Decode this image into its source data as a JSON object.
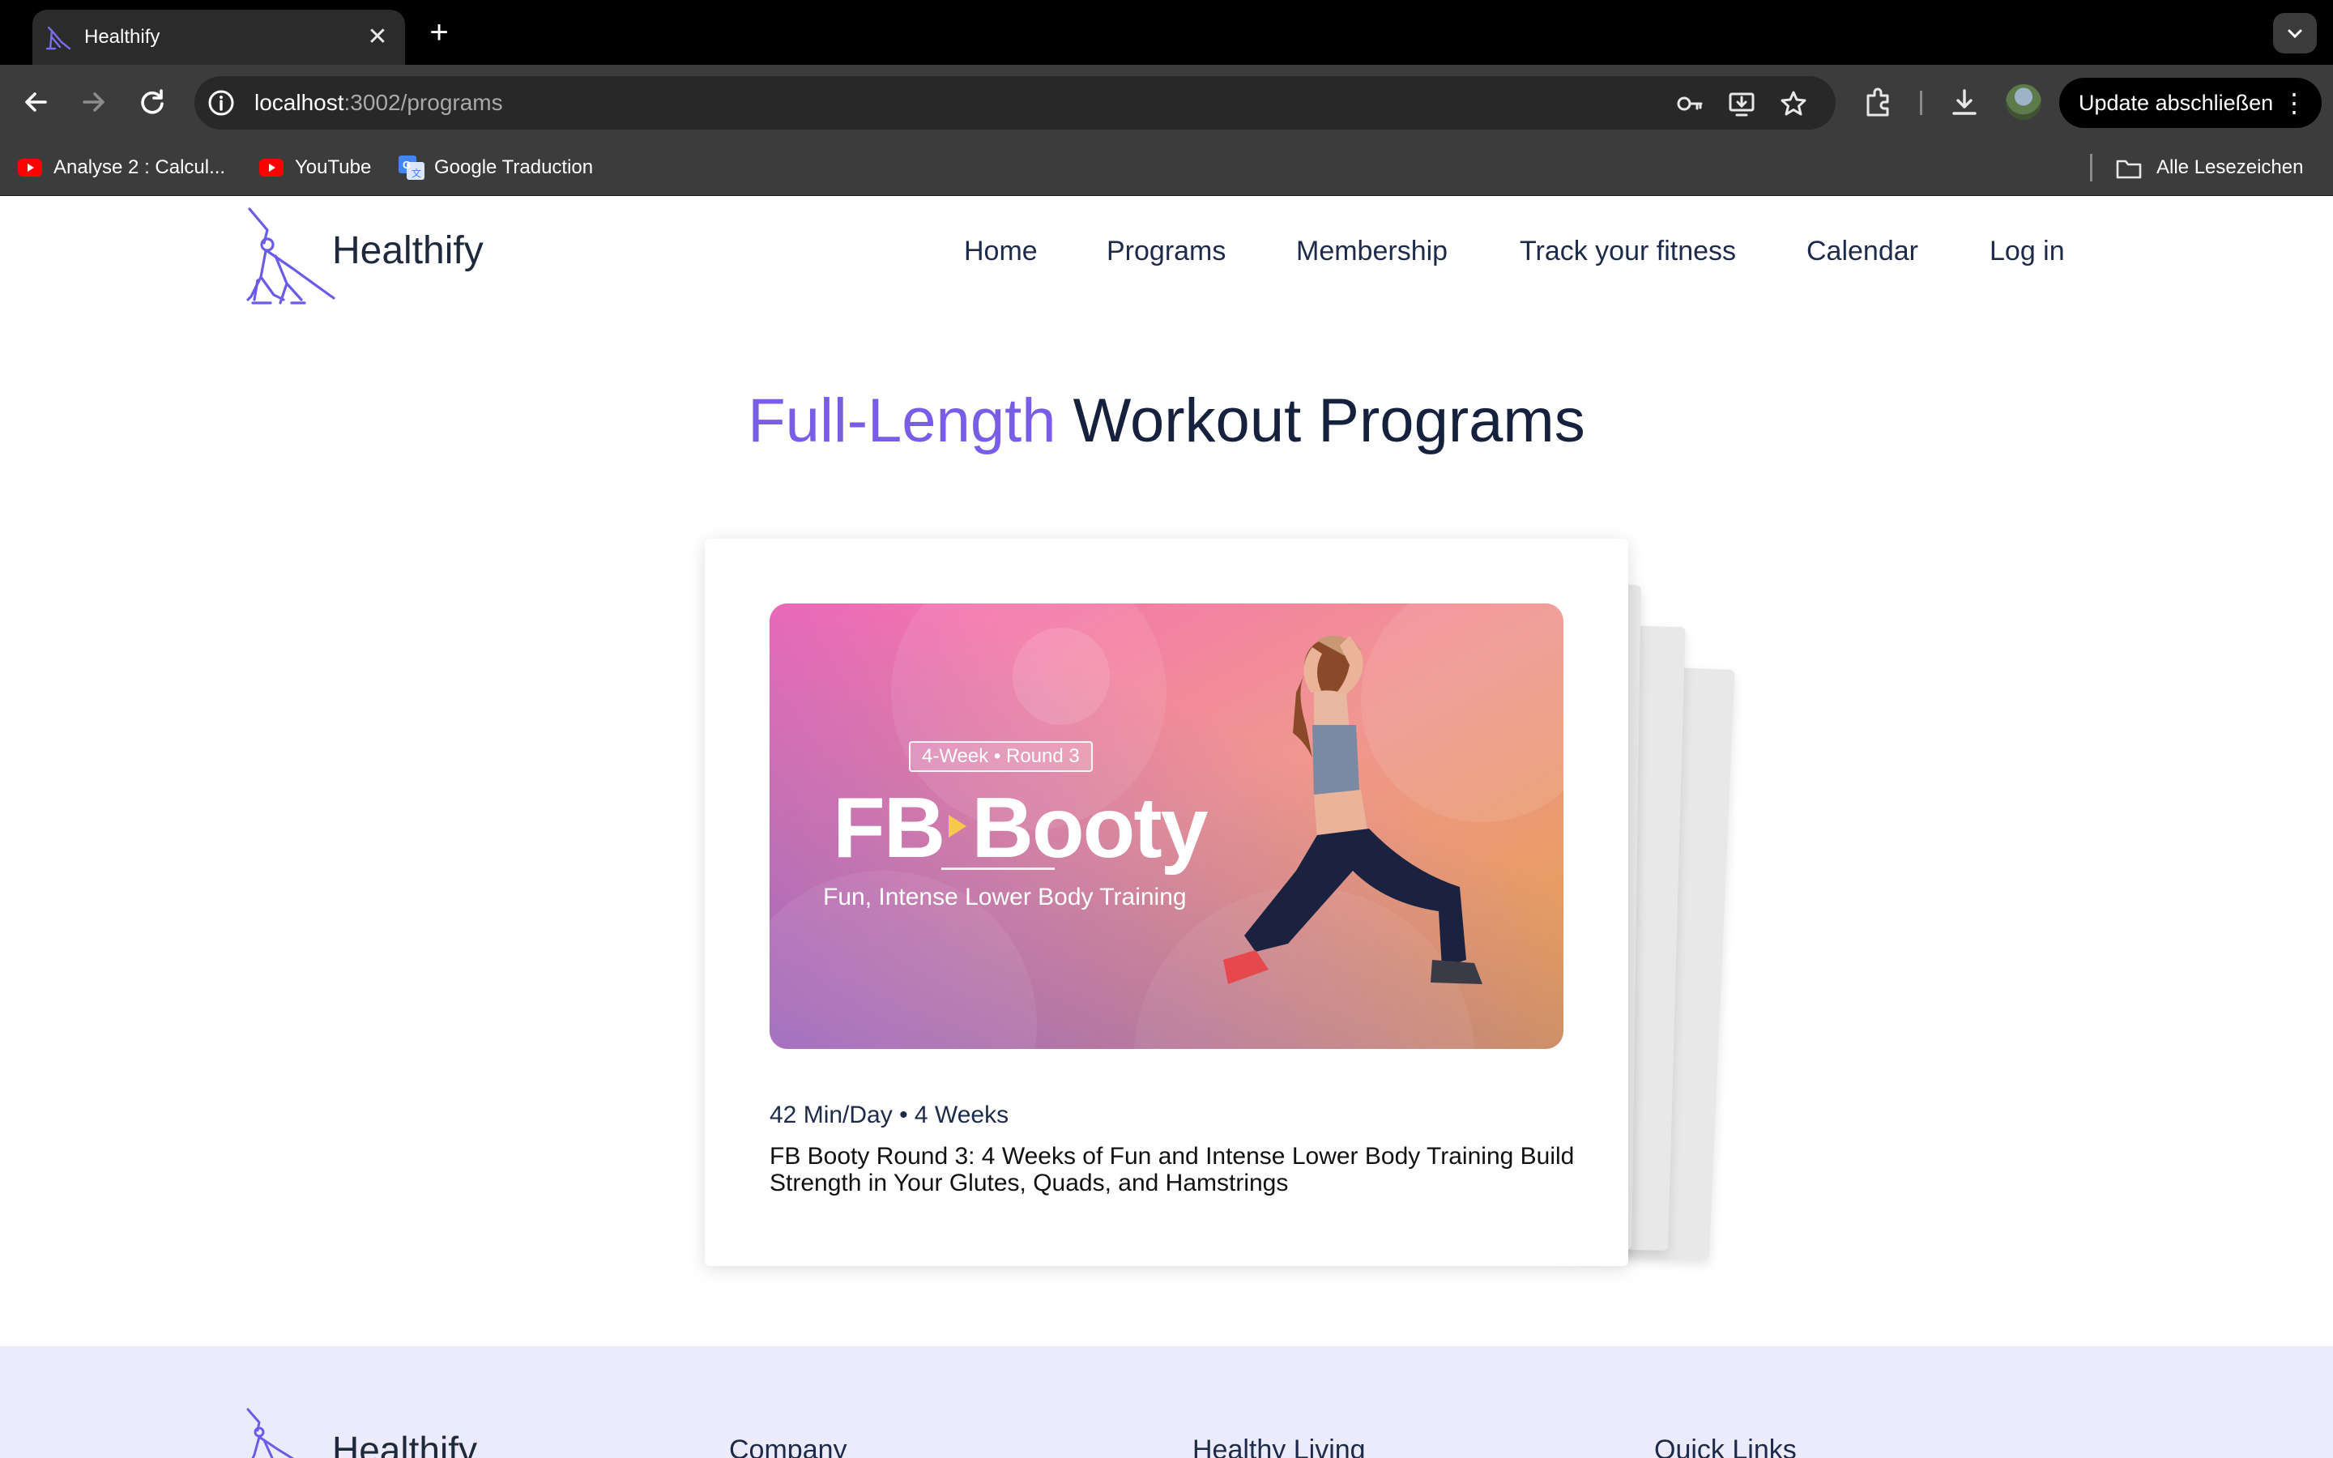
{
  "browser": {
    "tab_title": "Healthify",
    "tab_close": "✕",
    "new_tab": "+",
    "url_host": "localhost",
    "url_path": ":3002/programs",
    "update_label": "Update abschließen",
    "update_more": "⋮",
    "bookmarks": [
      {
        "label": "Analyse 2 : Calcul...",
        "icon": "youtube-icon"
      },
      {
        "label": "YouTube",
        "icon": "youtube-icon"
      },
      {
        "label": "Google Traduction",
        "icon": "google-translate-icon"
      }
    ],
    "all_bookmarks": "Alle Lesezeichen"
  },
  "site": {
    "logo": "Healthify",
    "nav": [
      "Home",
      "Programs",
      "Membership",
      "Track your fitness",
      "Calendar",
      "Log in"
    ],
    "accent_color": "#7a5de6",
    "text_color": "#1e2a4a"
  },
  "page": {
    "title_accent": "Full-Length",
    "title_rest": "Workout Programs"
  },
  "program": {
    "image": {
      "badge": "4-Week • Round 3",
      "title_left": "FB",
      "title_right": "Booty",
      "subtitle": "Fun, Intense Lower Body Training"
    },
    "meta": "42 Min/Day • 4 Weeks",
    "description": "FB Booty Round 3: 4 Weeks of Fun and Intense Lower Body Training Build Strength in Your Glutes, Quads, and Hamstrings"
  },
  "footer": {
    "logo": "Healthify",
    "columns": [
      "Company",
      "Healthy Living",
      "Quick Links"
    ]
  }
}
